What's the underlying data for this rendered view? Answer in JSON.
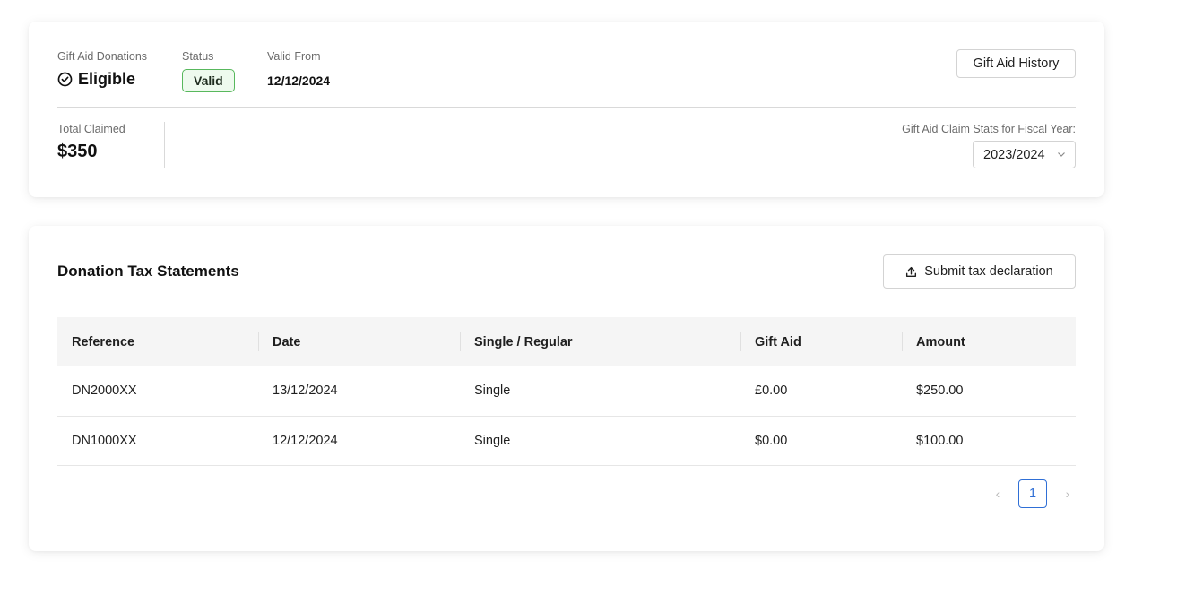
{
  "summary": {
    "gift_aid_label": "Gift Aid Donations",
    "gift_aid_value": "Eligible",
    "status_label": "Status",
    "status_value": "Valid",
    "valid_from_label": "Valid From",
    "valid_from_value": "12/12/2024",
    "history_button": "Gift Aid History",
    "total_claimed_label": "Total Claimed",
    "total_claimed_value": "$350",
    "fiscal_year_label": "Gift Aid Claim Stats for Fiscal Year:",
    "fiscal_year_value": "2023/2024"
  },
  "statements": {
    "title": "Donation Tax Statements",
    "submit_button": "Submit tax declaration",
    "columns": [
      "Reference",
      "Date",
      "Single / Regular",
      "Gift Aid",
      "Amount"
    ],
    "rows": [
      [
        "DN2000XX",
        "13/12/2024",
        "Single",
        "£0.00",
        "$250.00"
      ],
      [
        "DN1000XX",
        "12/12/2024",
        "Single",
        "$0.00",
        "$100.00"
      ]
    ]
  },
  "pagination": {
    "prev": "‹",
    "current": "1",
    "next": "›"
  },
  "colors": {
    "accent": "#2f6fd6",
    "status_green": "#58b85d"
  },
  "icons": [
    "check-circle-icon",
    "chevron-down-icon",
    "upload-icon",
    "chevron-left-icon",
    "chevron-right-icon"
  ]
}
